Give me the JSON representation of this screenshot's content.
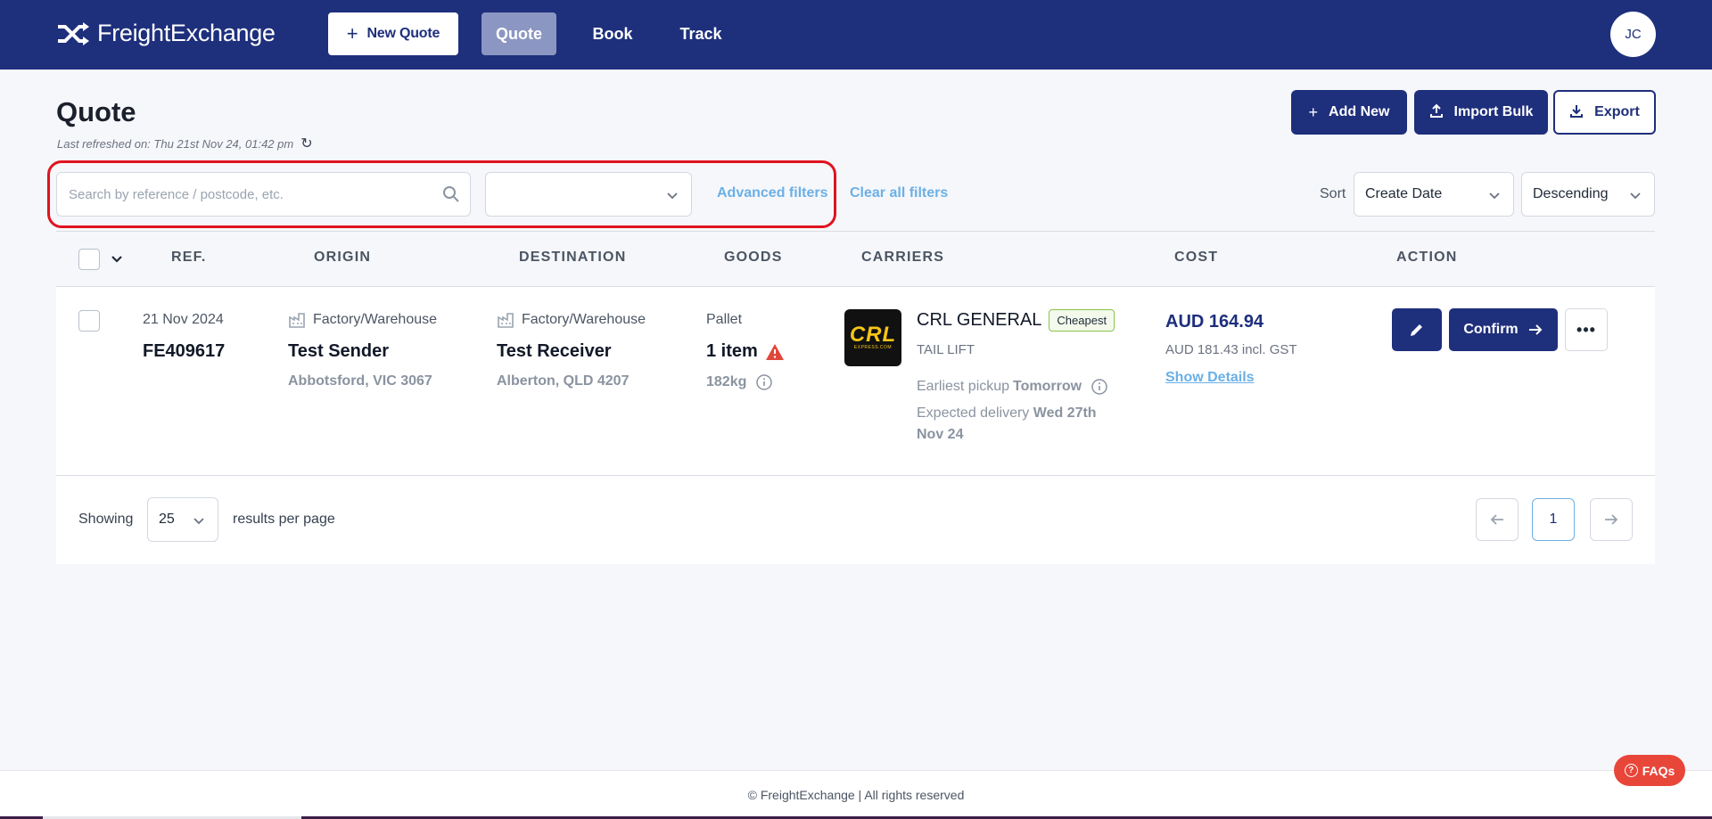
{
  "app": {
    "name": "FreightExchange"
  },
  "nav": {
    "new_quote": "New Quote",
    "tabs": [
      {
        "label": "Quote",
        "active": true
      },
      {
        "label": "Book",
        "active": false
      },
      {
        "label": "Track",
        "active": false
      }
    ],
    "user_initials": "JC"
  },
  "header": {
    "title": "Quote",
    "last_refreshed": "Last refreshed on: Thu 21st Nov 24, 01:42 pm",
    "buttons": {
      "add_new": "Add New",
      "import_bulk": "Import Bulk",
      "export": "Export"
    }
  },
  "filters": {
    "search_placeholder": "Search by reference / postcode, etc.",
    "search_value": "",
    "status_value": "",
    "advanced": "Advanced filters",
    "clear": "Clear all filters",
    "sort_label": "Sort",
    "sort_by": "Create Date",
    "sort_order": "Descending"
  },
  "table": {
    "columns": [
      "REF.",
      "ORIGIN",
      "DESTINATION",
      "GOODS",
      "CARRIERS",
      "COST",
      "ACTION"
    ],
    "rows": [
      {
        "date": "21 Nov 2024",
        "ref": "FE409617",
        "origin": {
          "type": "Factory/Warehouse",
          "name": "Test Sender",
          "location": "Abbotsford, VIC 3067"
        },
        "destination": {
          "type": "Factory/Warehouse",
          "name": "Test Receiver",
          "location": "Alberton, QLD 4207"
        },
        "goods": {
          "type": "Pallet",
          "items": "1 item",
          "weight": "182kg"
        },
        "carrier": {
          "logo_text": "CRL",
          "logo_subtext": "EXPRESS.COM",
          "name": "CRL GENERAL",
          "badge": "Cheapest",
          "service": "TAIL LIFT",
          "pickup_label": "Earliest pickup",
          "pickup_value": "Tomorrow",
          "delivery_label": "Expected delivery",
          "delivery_value_1": "Wed 27th",
          "delivery_value_2": "Nov 24"
        },
        "cost": {
          "price": "AUD 164.94",
          "incl_gst": "AUD 181.43 incl. GST",
          "details_link": "Show Details"
        },
        "actions": {
          "confirm": "Confirm"
        }
      }
    ]
  },
  "pagination": {
    "showing": "Showing",
    "per_page": "25",
    "per_page_suffix": "results per page",
    "current_page": "1"
  },
  "footer": {
    "copyright": "© FreightExchange | All rights reserved",
    "faqs": "FAQs"
  },
  "colors": {
    "brand_navy": "#1e2f7c",
    "link_blue": "#6bb0e6",
    "highlight_red": "#e0131f",
    "warning_red": "#e0473a",
    "badge_green": "#8bc34a"
  }
}
